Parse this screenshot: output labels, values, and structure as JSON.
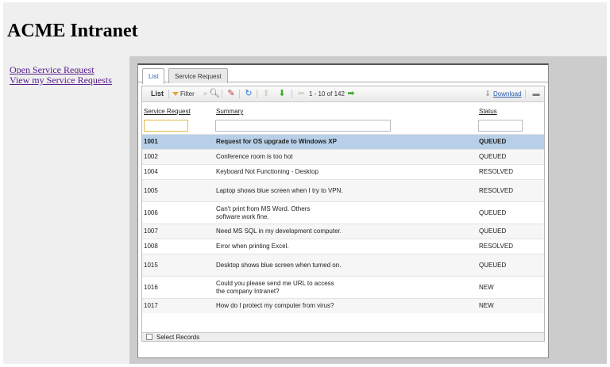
{
  "header": {
    "title": "ACME Intranet"
  },
  "sidebar": {
    "links": [
      {
        "label": "Open Service Request"
      },
      {
        "label": "View my Service Requests"
      }
    ]
  },
  "tabs": [
    {
      "label": "List",
      "active": true
    },
    {
      "label": "Service Request",
      "active": false
    }
  ],
  "toolbar": {
    "list_label": "List",
    "filter_label": "Filter",
    "filter_arrow": ">",
    "pager_text": "1 - 10 of 142",
    "download_label": "Download",
    "icons": [
      "funnel-icon",
      "search-icon",
      "edit-icon",
      "refresh-icon",
      "arrow-up-icon",
      "arrow-down-icon",
      "arrow-left-icon",
      "arrow-right-icon",
      "download-icon",
      "menu-icon"
    ]
  },
  "table": {
    "columns": [
      "Service Request",
      "Summary",
      "Status"
    ],
    "filters": {
      "service_request": "",
      "summary": "",
      "status": ""
    },
    "rows": [
      {
        "id": "1001",
        "summary": "Request for OS upgrade to Windows XP",
        "status": "QUEUED"
      },
      {
        "id": "1002",
        "summary": "Conference room is too hot",
        "status": "QUEUED"
      },
      {
        "id": "1004",
        "summary": "Keyboard Not Functioning - Desktop",
        "status": "RESOLVED"
      },
      {
        "id": "1005",
        "summary": "Laptop shows blue screen when I try to VPN.",
        "status": "RESOLVED"
      },
      {
        "id": "1006",
        "summary": "Can't print from MS Word. Others software work fine.",
        "status": "QUEUED"
      },
      {
        "id": "1007",
        "summary": "Need MS SQL in my development computer.",
        "status": "QUEUED"
      },
      {
        "id": "1008",
        "summary": "Error when printing Excel.",
        "status": "RESOLVED"
      },
      {
        "id": "1015",
        "summary": "Desktop shows blue screen when turned on.",
        "status": "QUEUED"
      },
      {
        "id": "1016",
        "summary": "Could you please send me URL to access the company Intranet?",
        "status": "NEW"
      },
      {
        "id": "1017",
        "summary": "How do I protect my computer from virus?",
        "status": "NEW"
      }
    ],
    "selected_row": "1001"
  },
  "select_records_label": "Select Records",
  "colors": {
    "selected_row": "#b8cfe8",
    "link": "#551a8b",
    "accent_green": "#3fae2a"
  }
}
